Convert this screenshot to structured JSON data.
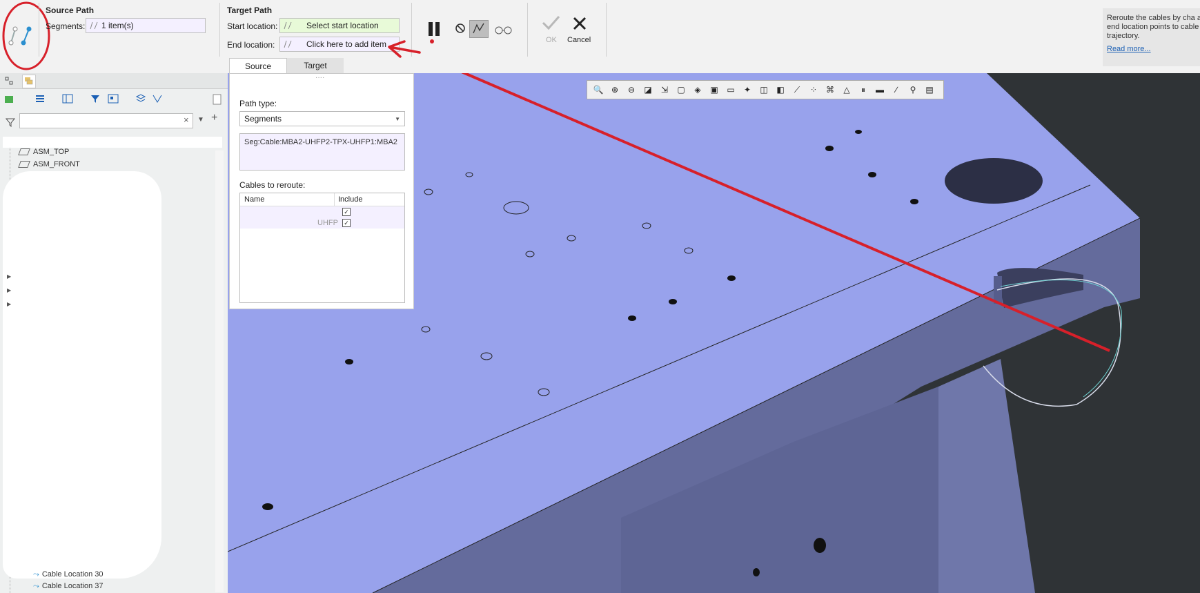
{
  "ribbon": {
    "source_path": {
      "title": "Source Path",
      "segments_label": "Segments:",
      "segments_value": "1 item(s)"
    },
    "target_path": {
      "title": "Target Path",
      "start_label": "Start location:",
      "start_value": "Select start location",
      "end_label": "End location:",
      "end_value": "Click here to add item"
    },
    "tabs": [
      "Source",
      "Target"
    ],
    "ok_label": "OK",
    "cancel_label": "Cancel",
    "help": {
      "text": "Reroute the cables by cha and end location points to cable trajectory.",
      "link": "Read more..."
    }
  },
  "tree": {
    "filter_placeholder": "",
    "items": [
      "ASM_TOP",
      "ASM_FRONT",
      "Cable Location 30",
      "Cable Location 37"
    ]
  },
  "panel": {
    "path_type_label": "Path type:",
    "path_type_value": "Segments",
    "segment_text": "Seg:Cable:MBA2-UHFP2-TPX-UHFP1:MBA2",
    "cables_label": "Cables to reroute:",
    "col_name": "Name",
    "col_include": "Include",
    "rows": [
      {
        "name": "",
        "checked": true
      },
      {
        "name": "UHFP",
        "checked": true
      }
    ]
  },
  "colors": {
    "annotation_red": "#d7202a",
    "part_top": "#98a2ec",
    "part_side": "#646b9c",
    "background": "#2f3336"
  }
}
